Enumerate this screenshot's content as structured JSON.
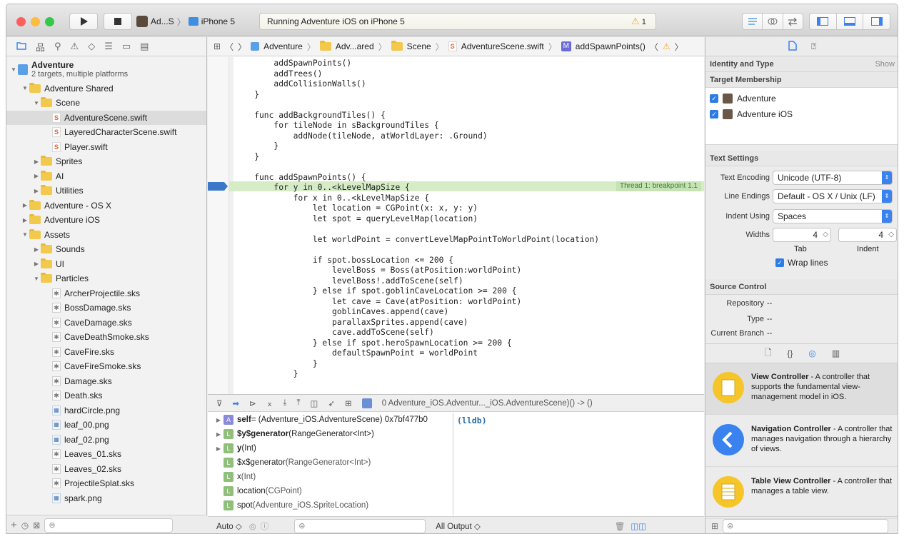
{
  "toolbar": {
    "scheme_target": "Ad...S",
    "scheme_device": "iPhone 5",
    "activity_text": "Running Adventure iOS on iPhone 5",
    "warning_count": "1"
  },
  "navigator": {
    "rows": [
      {
        "indent": 0,
        "disc": "▼",
        "icon": "proj",
        "label": "Adventure",
        "sub": "2 targets, multiple platforms",
        "bold": true
      },
      {
        "indent": 1,
        "disc": "▼",
        "icon": "folder",
        "label": "Adventure Shared"
      },
      {
        "indent": 2,
        "disc": "▼",
        "icon": "folder",
        "label": "Scene"
      },
      {
        "indent": 3,
        "disc": "",
        "icon": "swift",
        "label": "AdventureScene.swift",
        "selected": true
      },
      {
        "indent": 3,
        "disc": "",
        "icon": "swift",
        "label": "LayeredCharacterScene.swift"
      },
      {
        "indent": 3,
        "disc": "",
        "icon": "swift",
        "label": "Player.swift"
      },
      {
        "indent": 2,
        "disc": "▶",
        "icon": "folder",
        "label": "Sprites"
      },
      {
        "indent": 2,
        "disc": "▶",
        "icon": "folder",
        "label": "AI"
      },
      {
        "indent": 2,
        "disc": "▶",
        "icon": "folder",
        "label": "Utilities"
      },
      {
        "indent": 1,
        "disc": "▶",
        "icon": "folder",
        "label": "Adventure - OS X"
      },
      {
        "indent": 1,
        "disc": "▶",
        "icon": "folder",
        "label": "Adventure iOS"
      },
      {
        "indent": 1,
        "disc": "▼",
        "icon": "folder",
        "label": "Assets"
      },
      {
        "indent": 2,
        "disc": "▶",
        "icon": "folder",
        "label": "Sounds"
      },
      {
        "indent": 2,
        "disc": "▶",
        "icon": "folder",
        "label": "UI"
      },
      {
        "indent": 2,
        "disc": "▼",
        "icon": "folder",
        "label": "Particles"
      },
      {
        "indent": 3,
        "disc": "",
        "icon": "sks",
        "label": "ArcherProjectile.sks"
      },
      {
        "indent": 3,
        "disc": "",
        "icon": "sks",
        "label": "BossDamage.sks"
      },
      {
        "indent": 3,
        "disc": "",
        "icon": "sks",
        "label": "CaveDamage.sks"
      },
      {
        "indent": 3,
        "disc": "",
        "icon": "sks",
        "label": "CaveDeathSmoke.sks"
      },
      {
        "indent": 3,
        "disc": "",
        "icon": "sks",
        "label": "CaveFire.sks"
      },
      {
        "indent": 3,
        "disc": "",
        "icon": "sks",
        "label": "CaveFireSmoke.sks"
      },
      {
        "indent": 3,
        "disc": "",
        "icon": "sks",
        "label": "Damage.sks"
      },
      {
        "indent": 3,
        "disc": "",
        "icon": "sks",
        "label": "Death.sks"
      },
      {
        "indent": 3,
        "disc": "",
        "icon": "png",
        "label": "hardCircle.png"
      },
      {
        "indent": 3,
        "disc": "",
        "icon": "png",
        "label": "leaf_00.png"
      },
      {
        "indent": 3,
        "disc": "",
        "icon": "png",
        "label": "leaf_02.png"
      },
      {
        "indent": 3,
        "disc": "",
        "icon": "sks",
        "label": "Leaves_01.sks"
      },
      {
        "indent": 3,
        "disc": "",
        "icon": "sks",
        "label": "Leaves_02.sks"
      },
      {
        "indent": 3,
        "disc": "",
        "icon": "sks",
        "label": "ProjectileSplat.sks"
      },
      {
        "indent": 3,
        "disc": "",
        "icon": "png",
        "label": "spark.png"
      }
    ]
  },
  "jumpbar": {
    "items": [
      "Adventure",
      "Adv...ared",
      "Scene",
      "AdventureScene.swift",
      "addSpawnPoints()"
    ]
  },
  "code": {
    "lines": [
      "        addSpawnPoints()",
      "        addTrees()",
      "        addCollisionWalls()",
      "    }",
      "",
      "    func addBackgroundTiles() {",
      "        for tileNode in sBackgroundTiles {",
      "            addNode(tileNode, atWorldLayer: .Ground)",
      "        }",
      "    }",
      "",
      "    func addSpawnPoints() {",
      "        for y in 0..<kLevelMapSize {",
      "            for x in 0..<kLevelMapSize {",
      "                let location = CGPoint(x: x, y: y)",
      "                let spot = queryLevelMap(location)",
      "",
      "                let worldPoint = convertLevelMapPointToWorldPoint(location)",
      "",
      "                if spot.bossLocation <= 200 {",
      "                    levelBoss = Boss(atPosition:worldPoint)",
      "                    levelBoss!.addToScene(self)",
      "                } else if spot.goblinCaveLocation >= 200 {",
      "                    let cave = Cave(atPosition: worldPoint)",
      "                    goblinCaves.append(cave)",
      "                    parallaxSprites.append(cave)",
      "                    cave.addToScene(self)",
      "                } else if spot.heroSpawnLocation >= 200 {",
      "                    defaultSpawnPoint = worldPoint",
      "                }",
      "            }"
    ],
    "thread_label": "Thread 1: breakpoint 1.1"
  },
  "debug": {
    "frame_label": "0 Adventure_iOS.Adventur..._iOS.AdventureScene)() -> ()",
    "variables": [
      {
        "disc": "▶",
        "badge": "A",
        "badge_color": "#8a8ad8",
        "name": "self",
        "detail": " = (Adventure_iOS.AdventureScene) 0x7bf477b0",
        "bold": true
      },
      {
        "disc": "▶",
        "badge": "L",
        "badge_color": "#8fbf7a",
        "name": "$y$generator",
        "detail": " (RangeGenerator<Int>)",
        "bold": true
      },
      {
        "disc": "▶",
        "badge": "L",
        "badge_color": "#8fbf7a",
        "name": "y",
        "detail": " (Int)",
        "bold": true
      },
      {
        "disc": "",
        "badge": "L",
        "badge_color": "#8fbf7a",
        "name": "$x$generator",
        "detail": " (RangeGenerator<Int>)",
        "bold": false
      },
      {
        "disc": "",
        "badge": "L",
        "badge_color": "#8fbf7a",
        "name": "x",
        "detail": " (Int)",
        "bold": false
      },
      {
        "disc": "",
        "badge": "L",
        "badge_color": "#8fbf7a",
        "name": "location",
        "detail": " (CGPoint)",
        "bold": false
      },
      {
        "disc": "",
        "badge": "L",
        "badge_color": "#8fbf7a",
        "name": "spot",
        "detail": " (Adventure_iOS.SpriteLocation)",
        "bold": false
      }
    ],
    "console_prompt": "(lldb)",
    "auto_label": "Auto ◇",
    "all_output_label": "All Output ◇"
  },
  "inspector": {
    "identity_header": "Identity and Type",
    "show_label": "Show",
    "membership_header": "Target Membership",
    "targets": [
      "Adventure",
      "Adventure iOS"
    ],
    "text_settings_header": "Text Settings",
    "encoding_label": "Text Encoding",
    "encoding_value": "Unicode (UTF-8)",
    "endings_label": "Line Endings",
    "endings_value": "Default - OS X / Unix (LF)",
    "indent_label": "Indent Using",
    "indent_value": "Spaces",
    "widths_label": "Widths",
    "tab_width": "4",
    "indent_width": "4",
    "tab_label": "Tab",
    "indent_sub_label": "Indent",
    "wrap_label": "Wrap lines",
    "source_header": "Source Control",
    "repository_label": "Repository",
    "repository_value": "--",
    "type_label": "Type",
    "type_value": "--",
    "branch_label": "Current Branch",
    "branch_value": "--",
    "library": [
      {
        "title": "View Controller",
        "desc": " - A controller that supports the fundamental view-management model in iOS."
      },
      {
        "title": "Navigation Controller",
        "desc": " - A controller that manages navigation through a hierarchy of views."
      },
      {
        "title": "Table View Controller",
        "desc": " - A controller that manages a table view."
      }
    ]
  },
  "colors": {
    "close": "#fc605c",
    "minimize": "#fdbc40",
    "zoom": "#34c84a",
    "accent": "#3a82f0",
    "warning": "#f5a623"
  }
}
